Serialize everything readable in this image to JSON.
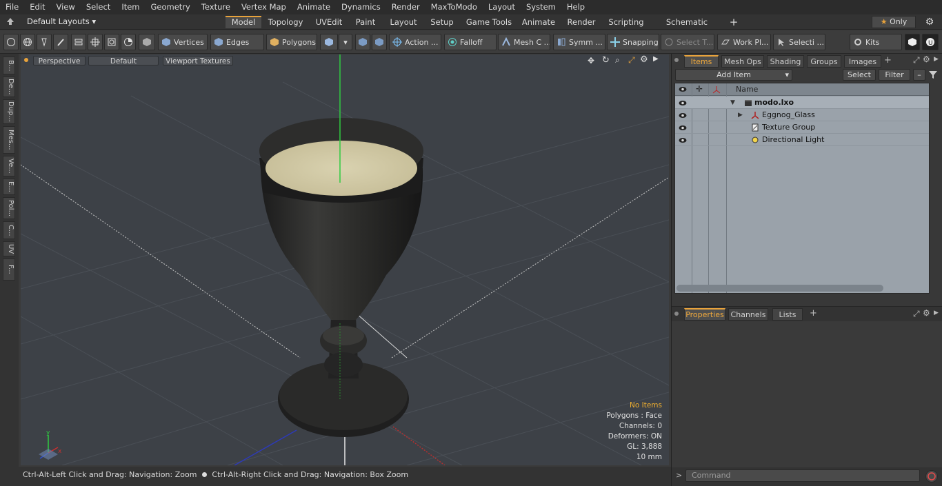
{
  "menu": [
    "File",
    "Edit",
    "View",
    "Select",
    "Item",
    "Geometry",
    "Texture",
    "Vertex Map",
    "Animate",
    "Dynamics",
    "Render",
    "MaxToModo",
    "Layout",
    "System",
    "Help"
  ],
  "layouts": {
    "dropdown": "Default Layouts",
    "tabs": [
      "Model",
      "Topology",
      "UVEdit",
      "Paint",
      "Layout",
      "Setup",
      "Game Tools",
      "Animate",
      "Render",
      "Scripting",
      "Schematic Fusion"
    ],
    "active_tab": "Model",
    "add": "+",
    "only_label": "Only"
  },
  "toolbar": {
    "vertices": "Vertices",
    "edges": "Edges",
    "polygons": "Polygons",
    "action": "Action ...",
    "falloff": "Falloff",
    "meshc": "Mesh C ...",
    "symm": "Symm ...",
    "snapping": "Snapping",
    "selectt": "Select T...",
    "workpl": "Work Pl...",
    "selecti": "Selecti ...",
    "kits": "Kits"
  },
  "left_tabs": [
    "B...",
    "De...",
    "Dup...",
    "Mes...",
    "Ve...",
    "E...",
    "Pol...",
    "C...",
    "UV",
    "F..."
  ],
  "viewport": {
    "view": "Perspective",
    "style": "Default",
    "textures": "Viewport Textures",
    "info": {
      "no_items": "No Items",
      "polygons": "Polygons : Face",
      "channels": "Channels: 0",
      "deformers": "Deformers: ON",
      "gl": "GL: 3,888",
      "scale": "10 mm"
    }
  },
  "status": {
    "hint1": "Ctrl-Alt-Left Click and Drag: Navigation: Zoom",
    "hint2": "Ctrl-Alt-Right Click and Drag: Navigation: Box Zoom"
  },
  "items_panel": {
    "tabs": [
      "Items",
      "Mesh Ops",
      "Shading",
      "Groups",
      "Images"
    ],
    "active_tab": "Items",
    "add_item": "Add Item",
    "select": "Select",
    "filter": "Filter",
    "column_name": "Name",
    "rows": [
      {
        "name": "modo.lxo",
        "indent": 0,
        "bold": true
      },
      {
        "name": "Eggnog_Glass",
        "indent": 1,
        "bold": false
      },
      {
        "name": "Texture Group",
        "indent": 1,
        "bold": false
      },
      {
        "name": "Directional Light",
        "indent": 1,
        "bold": false
      }
    ]
  },
  "properties_panel": {
    "tabs": [
      "Properties",
      "Channels",
      "Lists"
    ],
    "active_tab": "Properties"
  },
  "command": {
    "placeholder": "Command"
  },
  "colors": {
    "accent": "#e8a33c",
    "viewport_bg": "#3d4147",
    "y_axis": "#2ecc40"
  }
}
